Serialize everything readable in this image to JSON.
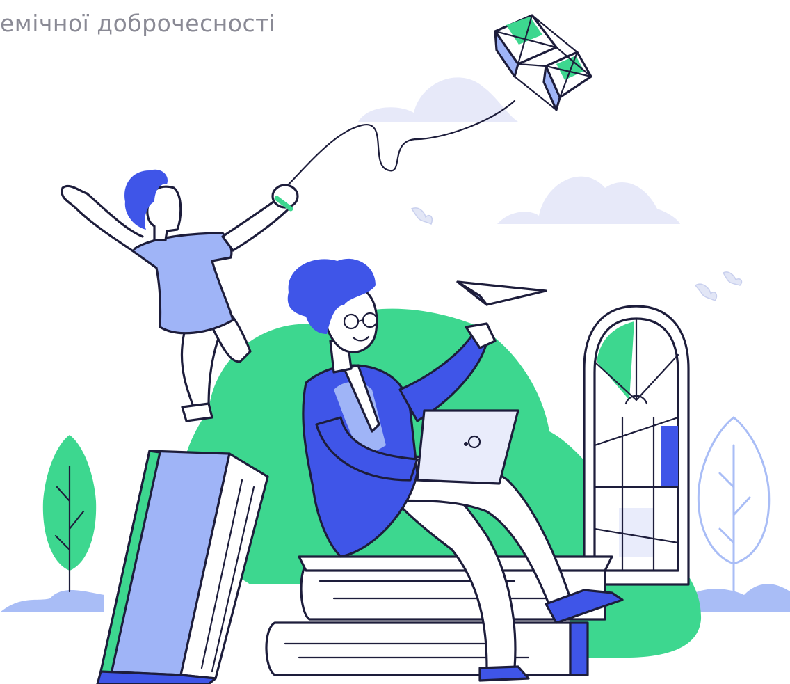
{
  "heading": {
    "text": "емічної доброчесності"
  },
  "colors": {
    "outline": "#1d1d3b",
    "green": "#3dd78f",
    "blue": "#3f55e8",
    "light_blue": "#9fb4f7",
    "pale_blue": "#e9ecfb",
    "cloud": "#e7e9f9",
    "white": "#ffffff"
  },
  "icons": {
    "kite": "kite-icon",
    "paper_plane": "paper-plane-icon",
    "laptop_logo": "laptop-logo-icon"
  }
}
